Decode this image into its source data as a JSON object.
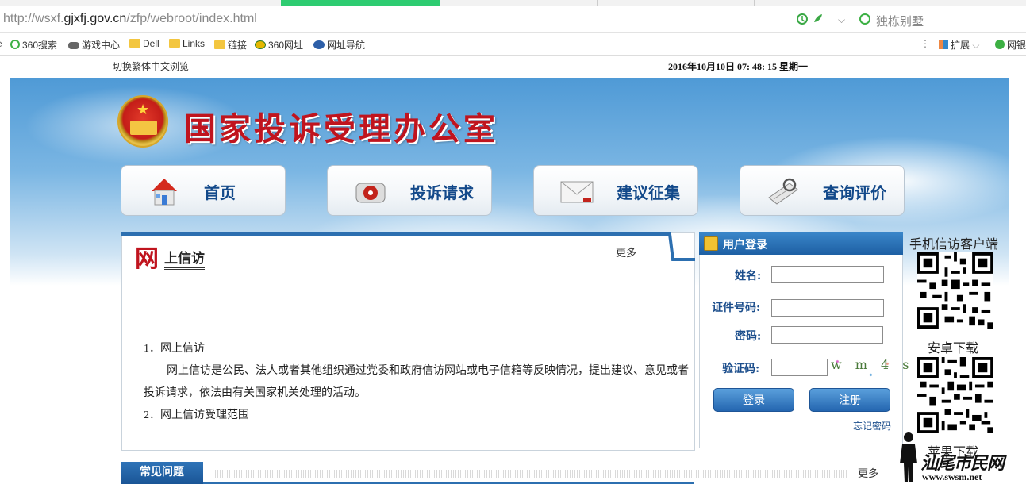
{
  "browser": {
    "url_prefix": "http://wsxf.",
    "url_domain": "gjxfj.gov.cn",
    "url_path": "/zfp/webroot/index.html",
    "search_placeholder": "独栋别墅",
    "bookmarks": [
      "360搜索",
      "游戏中心",
      "Dell",
      "Links",
      "链接",
      "360网址",
      "网址导航"
    ],
    "ext_label": "扩展",
    "ext_label2": "网银"
  },
  "topbar": {
    "toggle_traditional": "切换繁体中文浏览",
    "datetime": "2016年10月10日 07: 48: 15 星期一"
  },
  "header": {
    "site_title": "国家投诉受理办公室"
  },
  "nav": [
    {
      "label": "首页",
      "icon": "house-icon"
    },
    {
      "label": "投诉请求",
      "icon": "mailbox-icon"
    },
    {
      "label": "建议征集",
      "icon": "envelope-icon"
    },
    {
      "label": "查询评价",
      "icon": "search-document-icon"
    }
  ],
  "online_petition": {
    "big_char": "网",
    "title": "上信访",
    "more": "更多",
    "item1": "1．网上信访",
    "para_line1": "网上信访是公民、法人或者其他组织通过党委和政府信访网站或电子信箱等反映情况，提出建议、意见或者",
    "para_line2": "投诉请求，依法由有关国家机关处理的活动。",
    "item2": "2．网上信访受理范围"
  },
  "login": {
    "title": "用户登录",
    "name_label": "姓名:",
    "id_label": "证件号码:",
    "password_label": "密码:",
    "captcha_label": "验证码:",
    "captcha_text": "w m 4 s",
    "login_button": "登录",
    "register_button": "注册",
    "forgot_link": "忘记密码"
  },
  "right_column": {
    "mobile_client": "手机信访客户端",
    "android_download": "安卓下载",
    "apple_download": "苹果下载"
  },
  "faq": {
    "tab_label": "常见问题",
    "more": "更多"
  },
  "watermark": {
    "text": "汕尾市民网",
    "url": "www.swsm.net"
  }
}
